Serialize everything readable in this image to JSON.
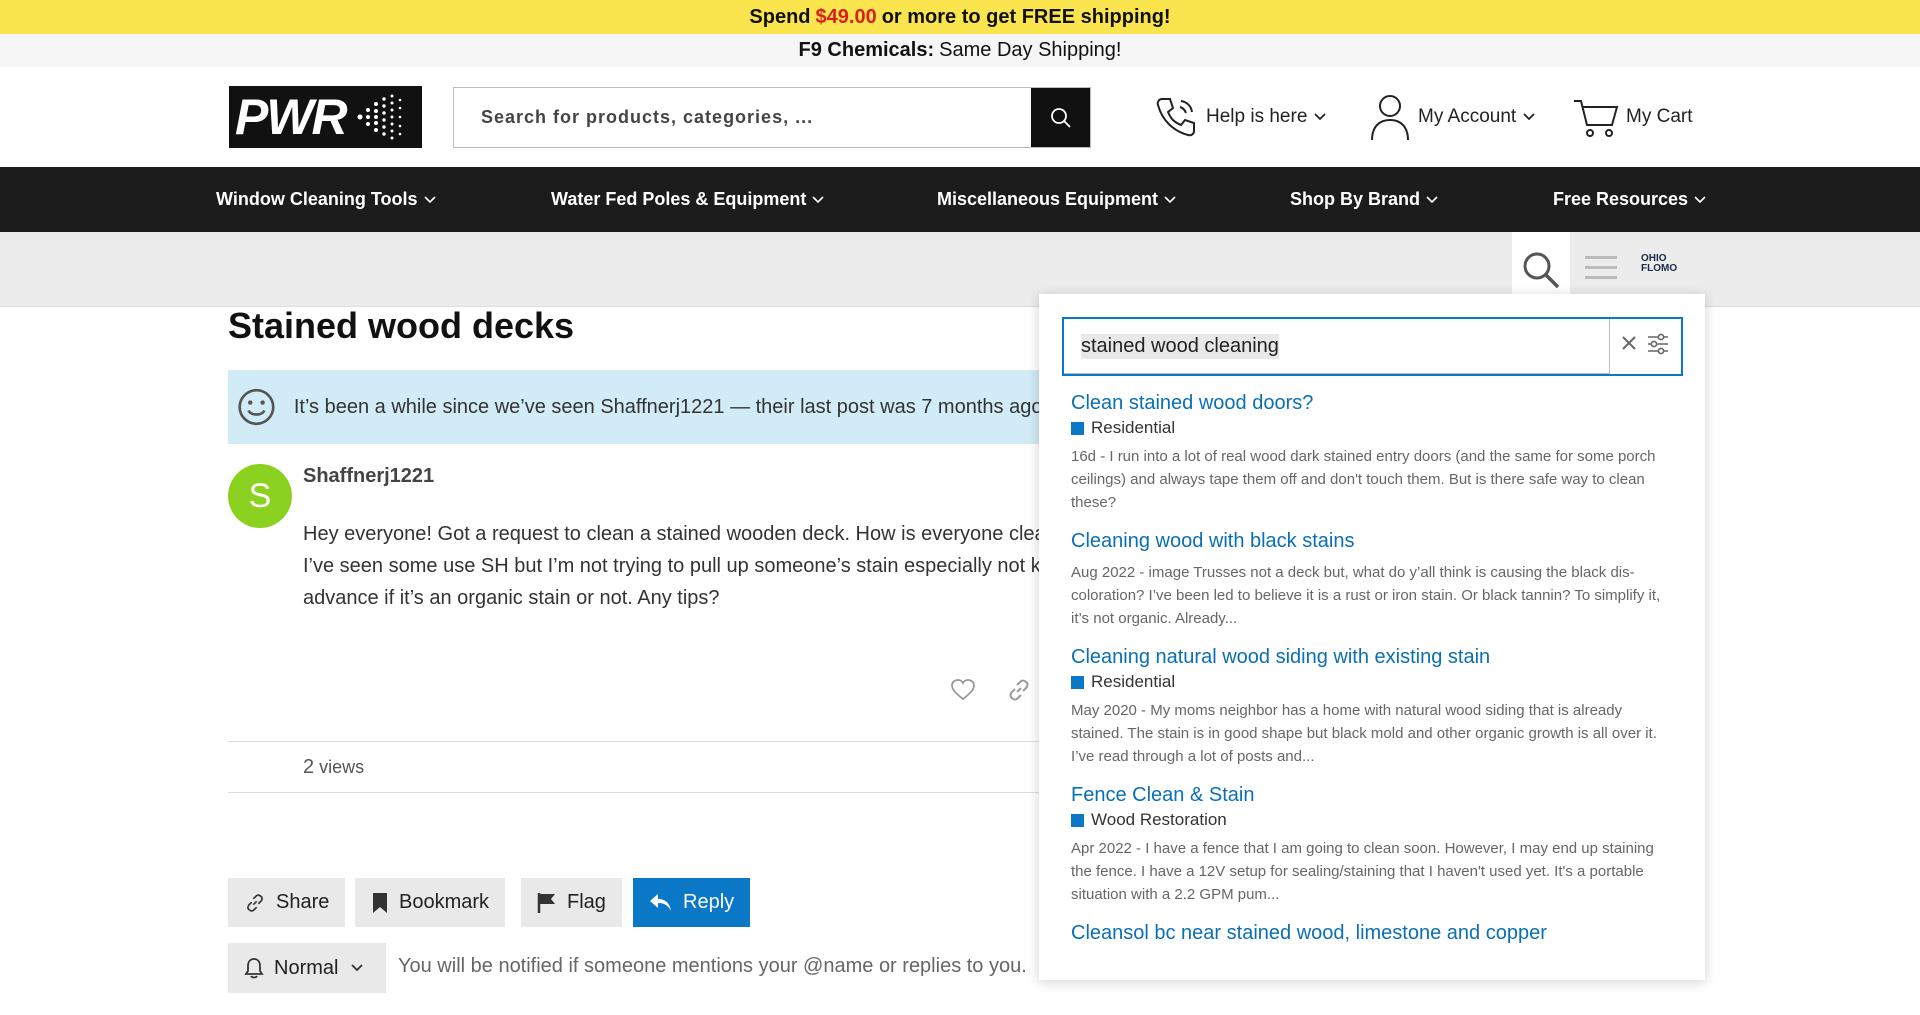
{
  "promo": {
    "prefix": "Spend",
    "amount": "$49.00",
    "suffix": "or more to get FREE shipping!"
  },
  "subpromo": {
    "bold": "F9 Chemicals:",
    "text": "Same Day Shipping!"
  },
  "header": {
    "logo_text": "PWR",
    "search_placeholder": "Search for products, categories, ...",
    "help_label": "Help is here",
    "account_label": "My Account",
    "cart_label": "My Cart"
  },
  "nav": {
    "items": [
      {
        "label": "Window Cleaning Tools"
      },
      {
        "label": "Water Fed Poles & Equipment"
      },
      {
        "label": "Miscellaneous Equipment"
      },
      {
        "label": "Shop By Brand"
      },
      {
        "label": "Free Resources"
      }
    ]
  },
  "forum_bar": {
    "logo_line1": "OHIO",
    "logo_line2": "FLOMO"
  },
  "topic": {
    "title": "Stained wood decks",
    "notice": "It’s been a while since we’ve seen Shaffnerj1221 — their last post was 7 months ago.",
    "avatar_letter": "S",
    "username": "Shaffnerj1221",
    "body_lines": [
      "Hey everyone! Got a request to clean a stained wooden deck. How is everyone cleaning these?",
      "I’ve seen some use SH but I’m not trying to pull up someone’s stain especially not knowing in",
      "advance if it’s an organic stain or not. Any tips?"
    ],
    "views_count": "2",
    "views_label": "views"
  },
  "actions": {
    "share": "Share",
    "bookmark": "Bookmark",
    "flag": "Flag",
    "reply": "Reply",
    "notify_level": "Normal",
    "notify_text": "You will be notified if someone mentions your @name or replies to you."
  },
  "search_panel": {
    "query": "stained wood cleaning",
    "results": [
      {
        "title": "Clean stained wood doors?",
        "category": "Residential",
        "blurb": "16d - I run into a lot of real wood dark stained entry doors (and the same for some porch ceilings) and always tape them off and don't touch them. But is there safe way to clean these?"
      },
      {
        "title": "Cleaning wood with black stains",
        "category": "",
        "blurb": "Aug 2022 - image Trusses not a deck but, what do y’all think is causing the black dis­coloration? I’ve been led to believe it is a rust or iron stain. Or black tannin? To simpli­fy it, it’s not organic. Already..."
      },
      {
        "title": "Cleaning natural wood siding with existing stain",
        "category": "Residential",
        "blurb": "May 2020 - My moms neighbor has a home with natural wood siding that is already stained. The stain is in good shape but black mold and other organic growth is all over it. I’ve read through a lot of posts and..."
      },
      {
        "title": "Fence Clean & Stain",
        "category": "Wood Restoration",
        "blurb": "Apr 2022 - I have a fence that I am going to clean soon. However, I may end up stain­ing the fence. I have a 12V setup for sealing/staining that I haven't used yet. It's a por­table situation with a 2.2 GPM pum..."
      },
      {
        "title": "Cleansol bc near stained wood, limestone and copper",
        "category": "",
        "blurb": ""
      }
    ]
  },
  "colors": {
    "promo_bg": "#fbe54f",
    "accent": "#0a78c7",
    "nav_bg": "#1c1c1c",
    "avatar": "#8bd11f"
  }
}
